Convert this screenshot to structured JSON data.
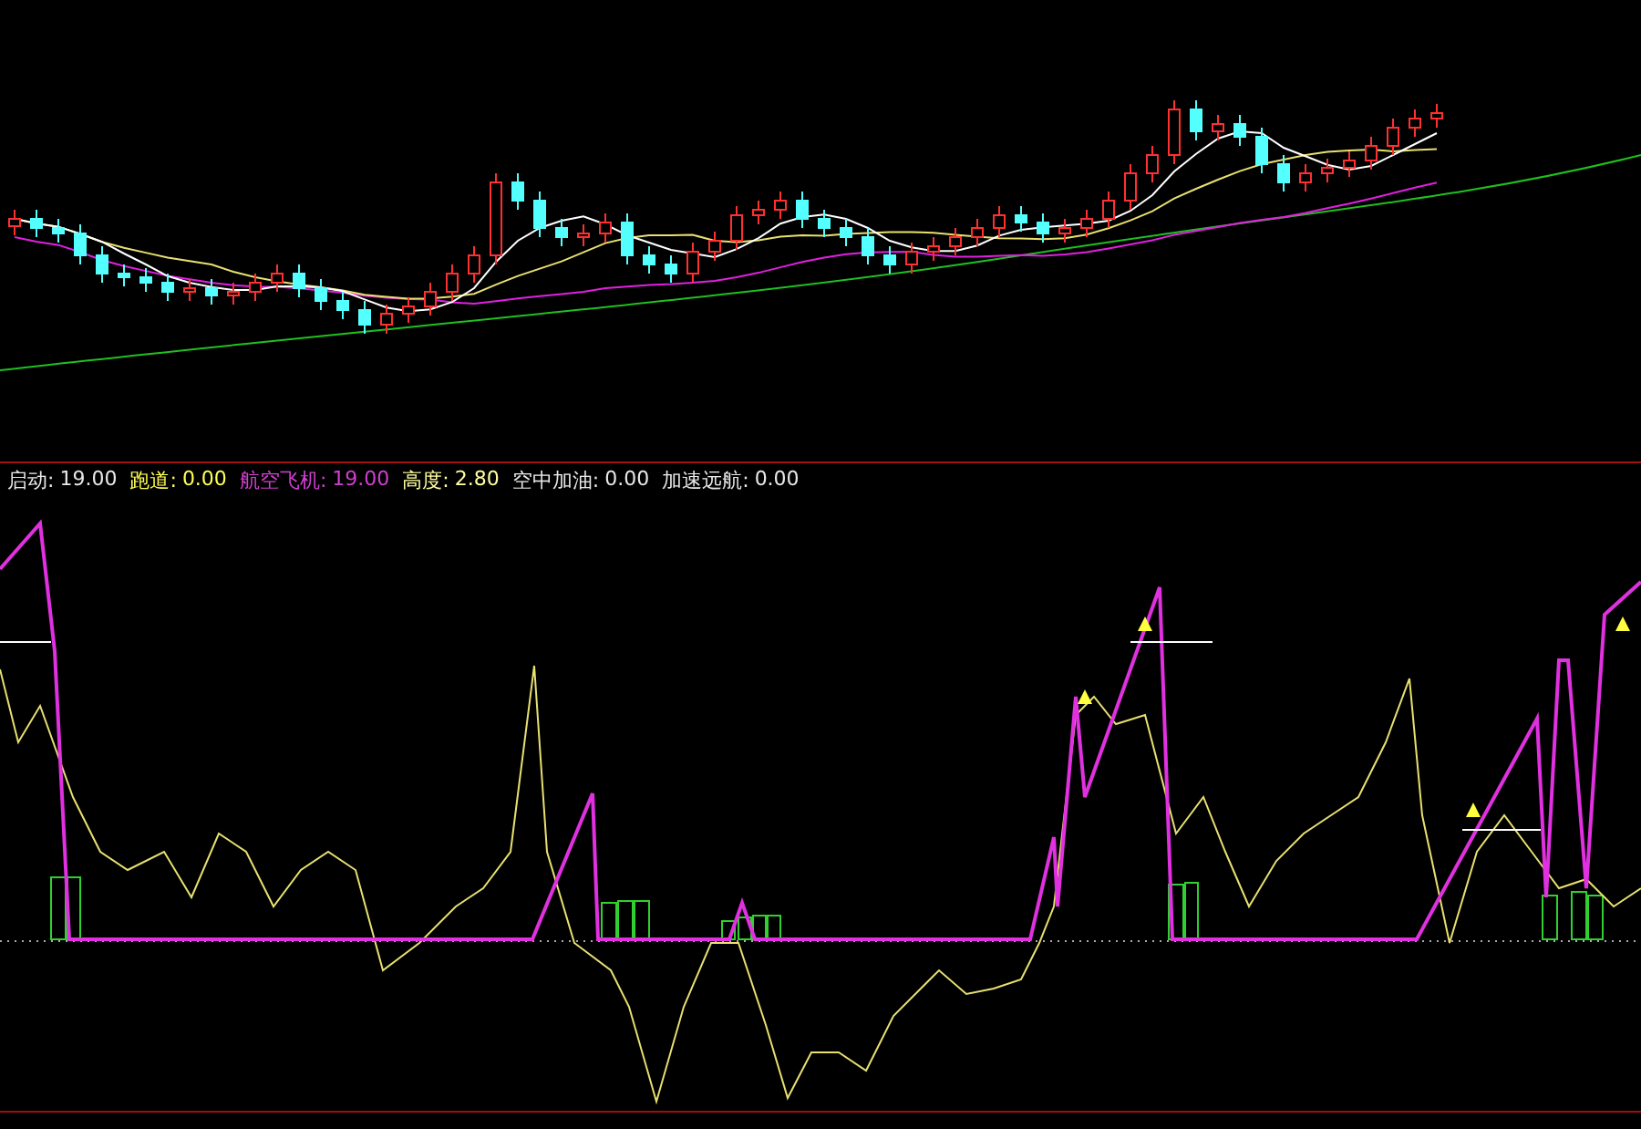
{
  "indicator_legend": [
    {
      "label": "启动:",
      "value": "19.00",
      "color": "#e8e8e8"
    },
    {
      "label": "跑道:",
      "value": "0.00",
      "color": "#ffff54"
    },
    {
      "label": "航空飞机:",
      "value": "19.00",
      "color": "#d040d0"
    },
    {
      "label": "高度:",
      "value": "2.80",
      "color": "#ffffa0"
    },
    {
      "label": "空中加油:",
      "value": "0.00",
      "color": "#e8e8e8"
    },
    {
      "label": "加速远航:",
      "value": "0.00",
      "color": "#e8e8e8"
    }
  ]
}
